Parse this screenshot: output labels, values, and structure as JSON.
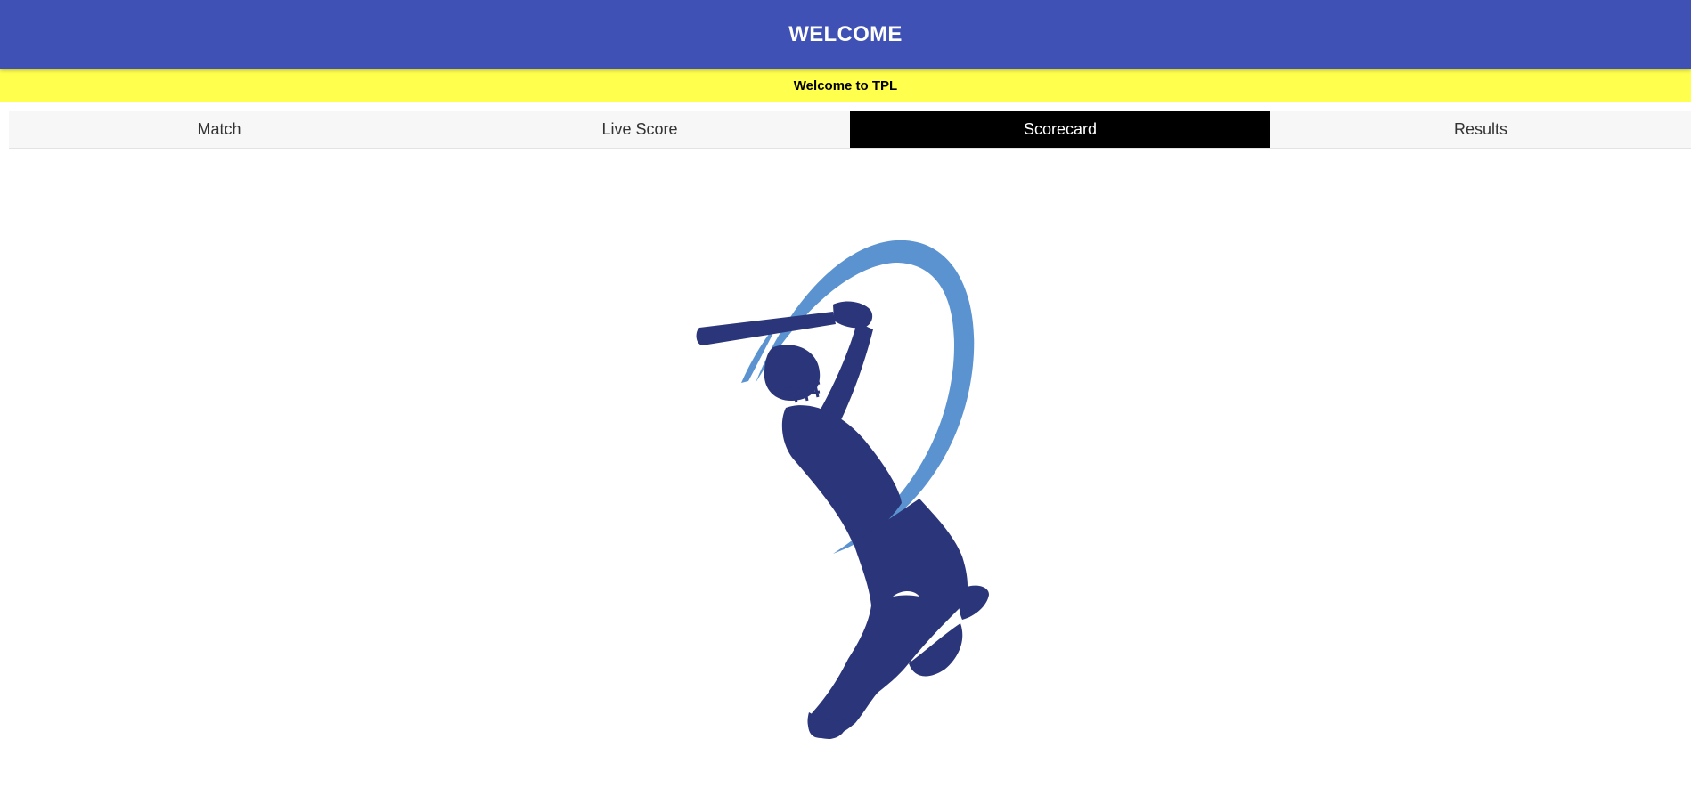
{
  "header": {
    "title": "WELCOME"
  },
  "marquee": {
    "text": "Welcome to TPL"
  },
  "tabs": [
    {
      "label": "Match",
      "active": false
    },
    {
      "label": "Live Score",
      "active": false
    },
    {
      "label": "Scorecard",
      "active": true
    },
    {
      "label": "Results",
      "active": false
    }
  ],
  "colors": {
    "app_bar": "#3f51b5",
    "marquee_bg": "#ffff4d",
    "active_tab_bg": "#000000",
    "logo_dark_blue": "#2b357a",
    "logo_light_blue": "#5b93d1"
  },
  "logo": {
    "icon": "cricket-batsman-logo"
  }
}
